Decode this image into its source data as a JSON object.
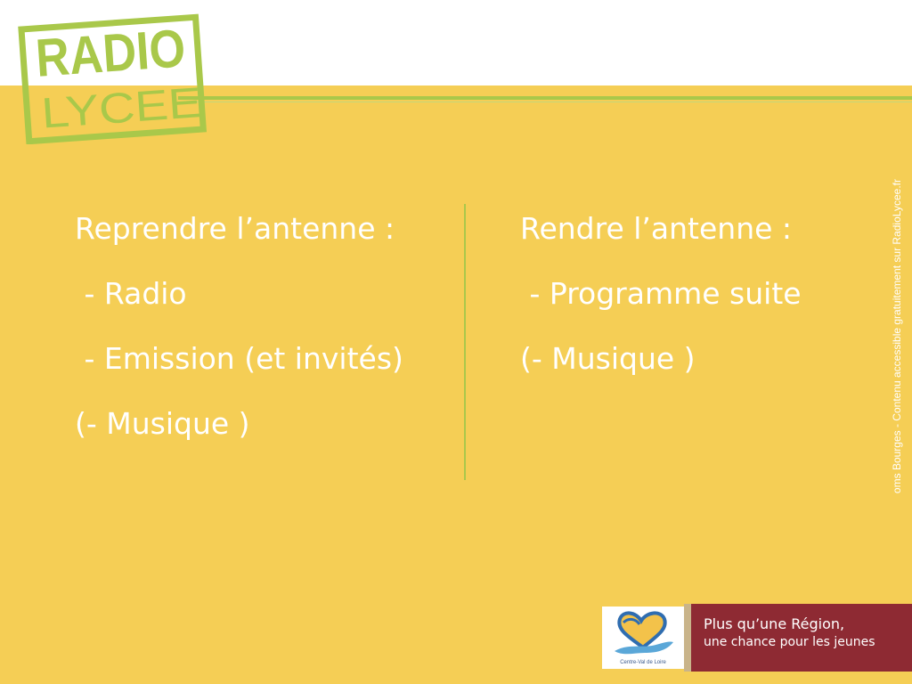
{
  "logo": {
    "line1": "RADIO",
    "line2": "LYCEE",
    "color": "#a9c84a"
  },
  "colors": {
    "background": "#f5ce55",
    "accent_green": "#a9c84a",
    "text": "#ffffff",
    "region_red": "#8e2a33"
  },
  "left_column": {
    "heading": "Reprendre l’antenne :",
    "items": [
      " - Radio",
      " - Emission (et invités)",
      "(- Musique )"
    ]
  },
  "right_column": {
    "heading": "Rendre l’antenne :",
    "items": [
      " - Programme suite",
      "(- Musique )"
    ]
  },
  "side_credit": "oms Bourges - Contenu accessible gratuitement sur RadioLycee.fr",
  "region_banner": {
    "logo_caption": "Centre-Val de Loire",
    "slogan_line1": "Plus qu’une Région,",
    "slogan_line2": "une chance pour les jeunes"
  }
}
